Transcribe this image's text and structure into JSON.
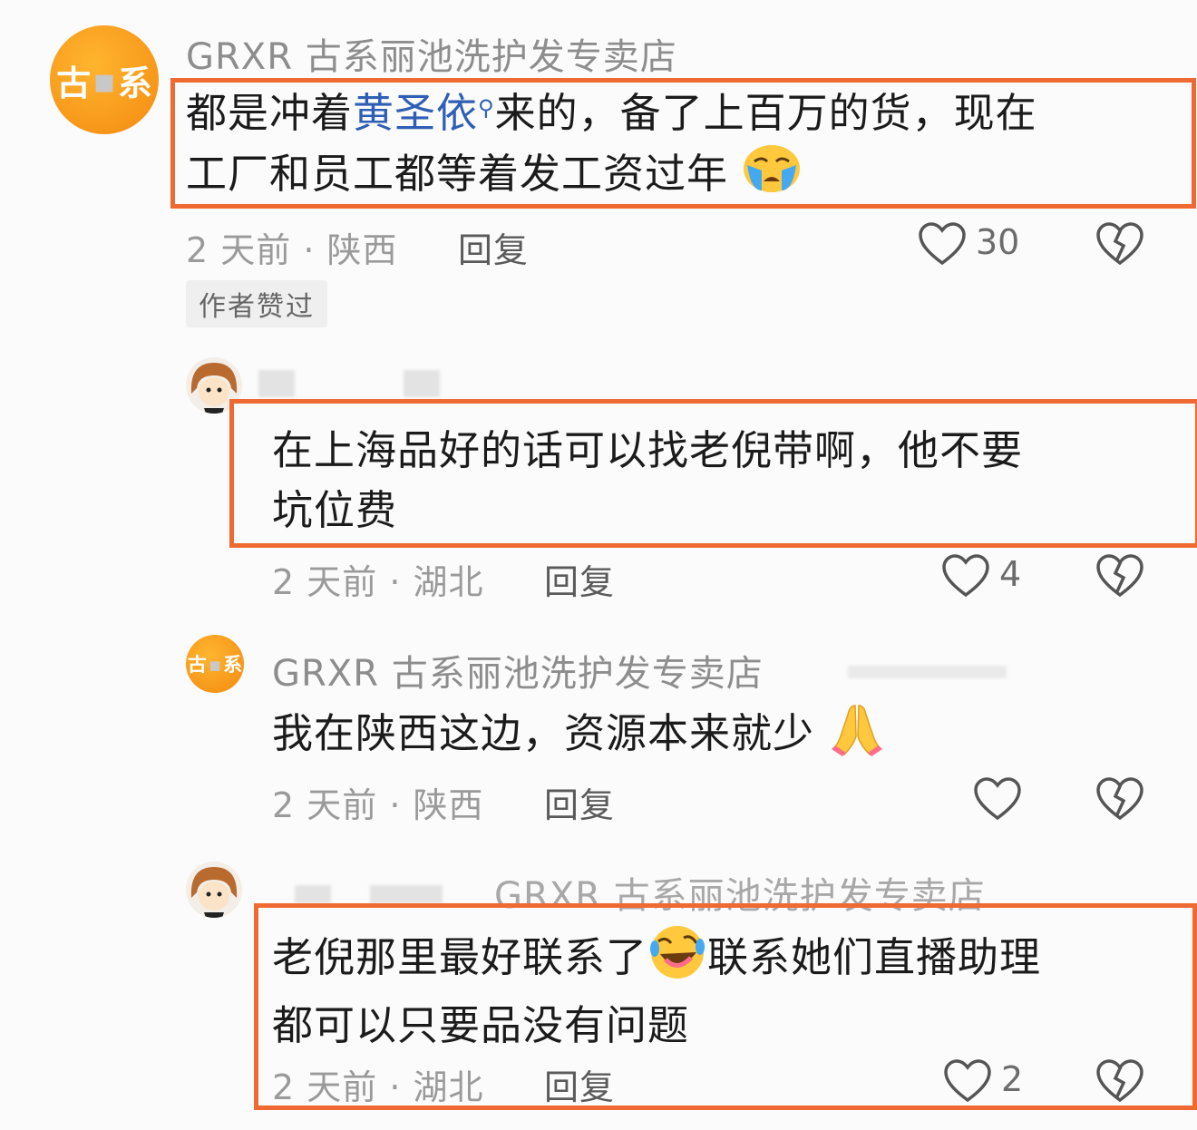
{
  "comments": [
    {
      "avatar_text": [
        "古",
        "系"
      ],
      "username": "GRXR 古系丽池洗护发专卖店",
      "text_line1_a": "都是冲着",
      "text_line1_link": "黄圣依",
      "text_line1_b": "来的，备了上百万的货，现在",
      "text_line2": "工厂和员工都等着发工资过年",
      "emoji": "crying-face",
      "time_loc": "2 天前 · 陕西",
      "reply_label": "回复",
      "likes": "30",
      "tag": "作者赞过"
    },
    {
      "text_line1": "在上海品好的话可以找老倪带啊，他不要",
      "text_line2": "坑位费",
      "time_loc": "2 天前 · 湖北",
      "reply_label": "回复",
      "likes": "4"
    },
    {
      "avatar_text": [
        "古",
        "系"
      ],
      "username": "GRXR 古系丽池洗护发专卖店",
      "text_line1": "我在陕西这边，资源本来就少",
      "emoji": "folded-hands",
      "time_loc": "2 天前 · 陕西",
      "reply_label": "回复",
      "likes": ""
    },
    {
      "reply_to": "GRXR 古系丽池洗护发专卖店",
      "text_line1_a": "老倪那里最好联系了",
      "text_line1_b": "联系她们直播助理",
      "text_line2": "都可以只要品没有问题",
      "emoji": "rolling-laughing",
      "time_loc": "2 天前 · 湖北",
      "reply_label": "回复",
      "likes": "2"
    }
  ],
  "colors": {
    "highlight_box": "#ef6a33",
    "brand_avatar": "#f7971a",
    "link": "#2f5fb5"
  }
}
